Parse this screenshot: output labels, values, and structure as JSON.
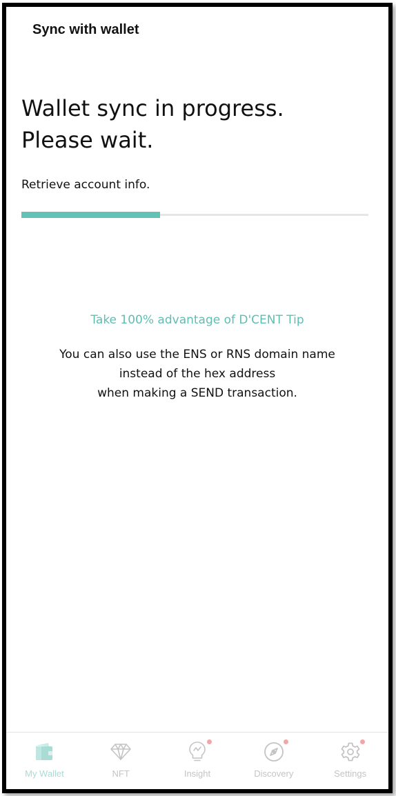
{
  "header": {
    "title": "Sync with wallet"
  },
  "main": {
    "headline_line1": "Wallet sync in progress.",
    "headline_line2": "Please wait.",
    "status": "Retrieve account info.",
    "progress_fraction": 0.4,
    "tip": {
      "title": "Take 100% advantage of D'CENT Tip",
      "body_line1": "You can also use the ENS or RNS domain name",
      "body_line2": "instead of the hex address",
      "body_line3": "when making a SEND transaction."
    }
  },
  "bottom_nav": {
    "items": [
      {
        "label": "My Wallet",
        "icon": "wallet-icon",
        "active": true,
        "badge": false
      },
      {
        "label": "NFT",
        "icon": "diamond-icon",
        "active": false,
        "badge": false
      },
      {
        "label": "Insight",
        "icon": "lightbulb-icon",
        "active": false,
        "badge": true
      },
      {
        "label": "Discovery",
        "icon": "compass-icon",
        "active": false,
        "badge": true
      },
      {
        "label": "Settings",
        "icon": "gear-icon",
        "active": false,
        "badge": true
      }
    ]
  },
  "colors": {
    "accent": "#63c2b6",
    "tip_title": "#5fbdb2",
    "nav_inactive": "#c4c4c4",
    "nav_active": "#a8dcd5",
    "badge": "#f2a6a6"
  }
}
